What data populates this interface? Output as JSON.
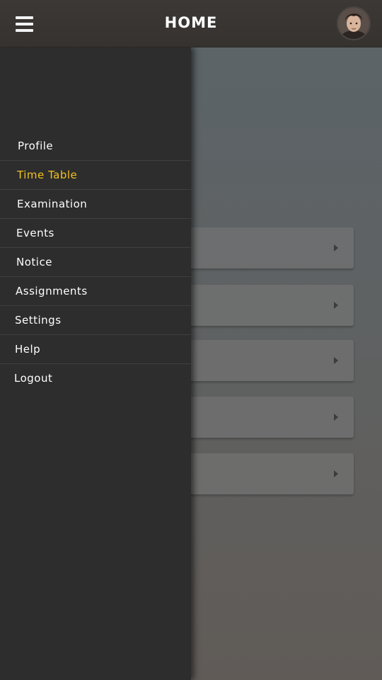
{
  "header": {
    "title": "HOME",
    "menu_icon": "hamburger-menu-icon",
    "avatar": "user-avatar"
  },
  "drawer": {
    "active_color": "#f3c21b",
    "items": [
      {
        "label": "Profile",
        "active": false
      },
      {
        "label": "Time Table",
        "active": true
      },
      {
        "label": "Examination",
        "active": false
      },
      {
        "label": "Events",
        "active": false
      },
      {
        "label": "Notice",
        "active": false
      },
      {
        "label": "Assignments",
        "active": false
      },
      {
        "label": "Settings",
        "active": false
      },
      {
        "label": "Help",
        "active": false
      },
      {
        "label": "Logout",
        "active": false
      }
    ]
  },
  "content": {
    "cards": [
      {
        "icon": "chevron-right-icon"
      },
      {
        "icon": "chevron-right-icon"
      },
      {
        "icon": "chevron-right-icon"
      },
      {
        "icon": "chevron-right-icon"
      },
      {
        "icon": "chevron-right-icon"
      }
    ]
  }
}
